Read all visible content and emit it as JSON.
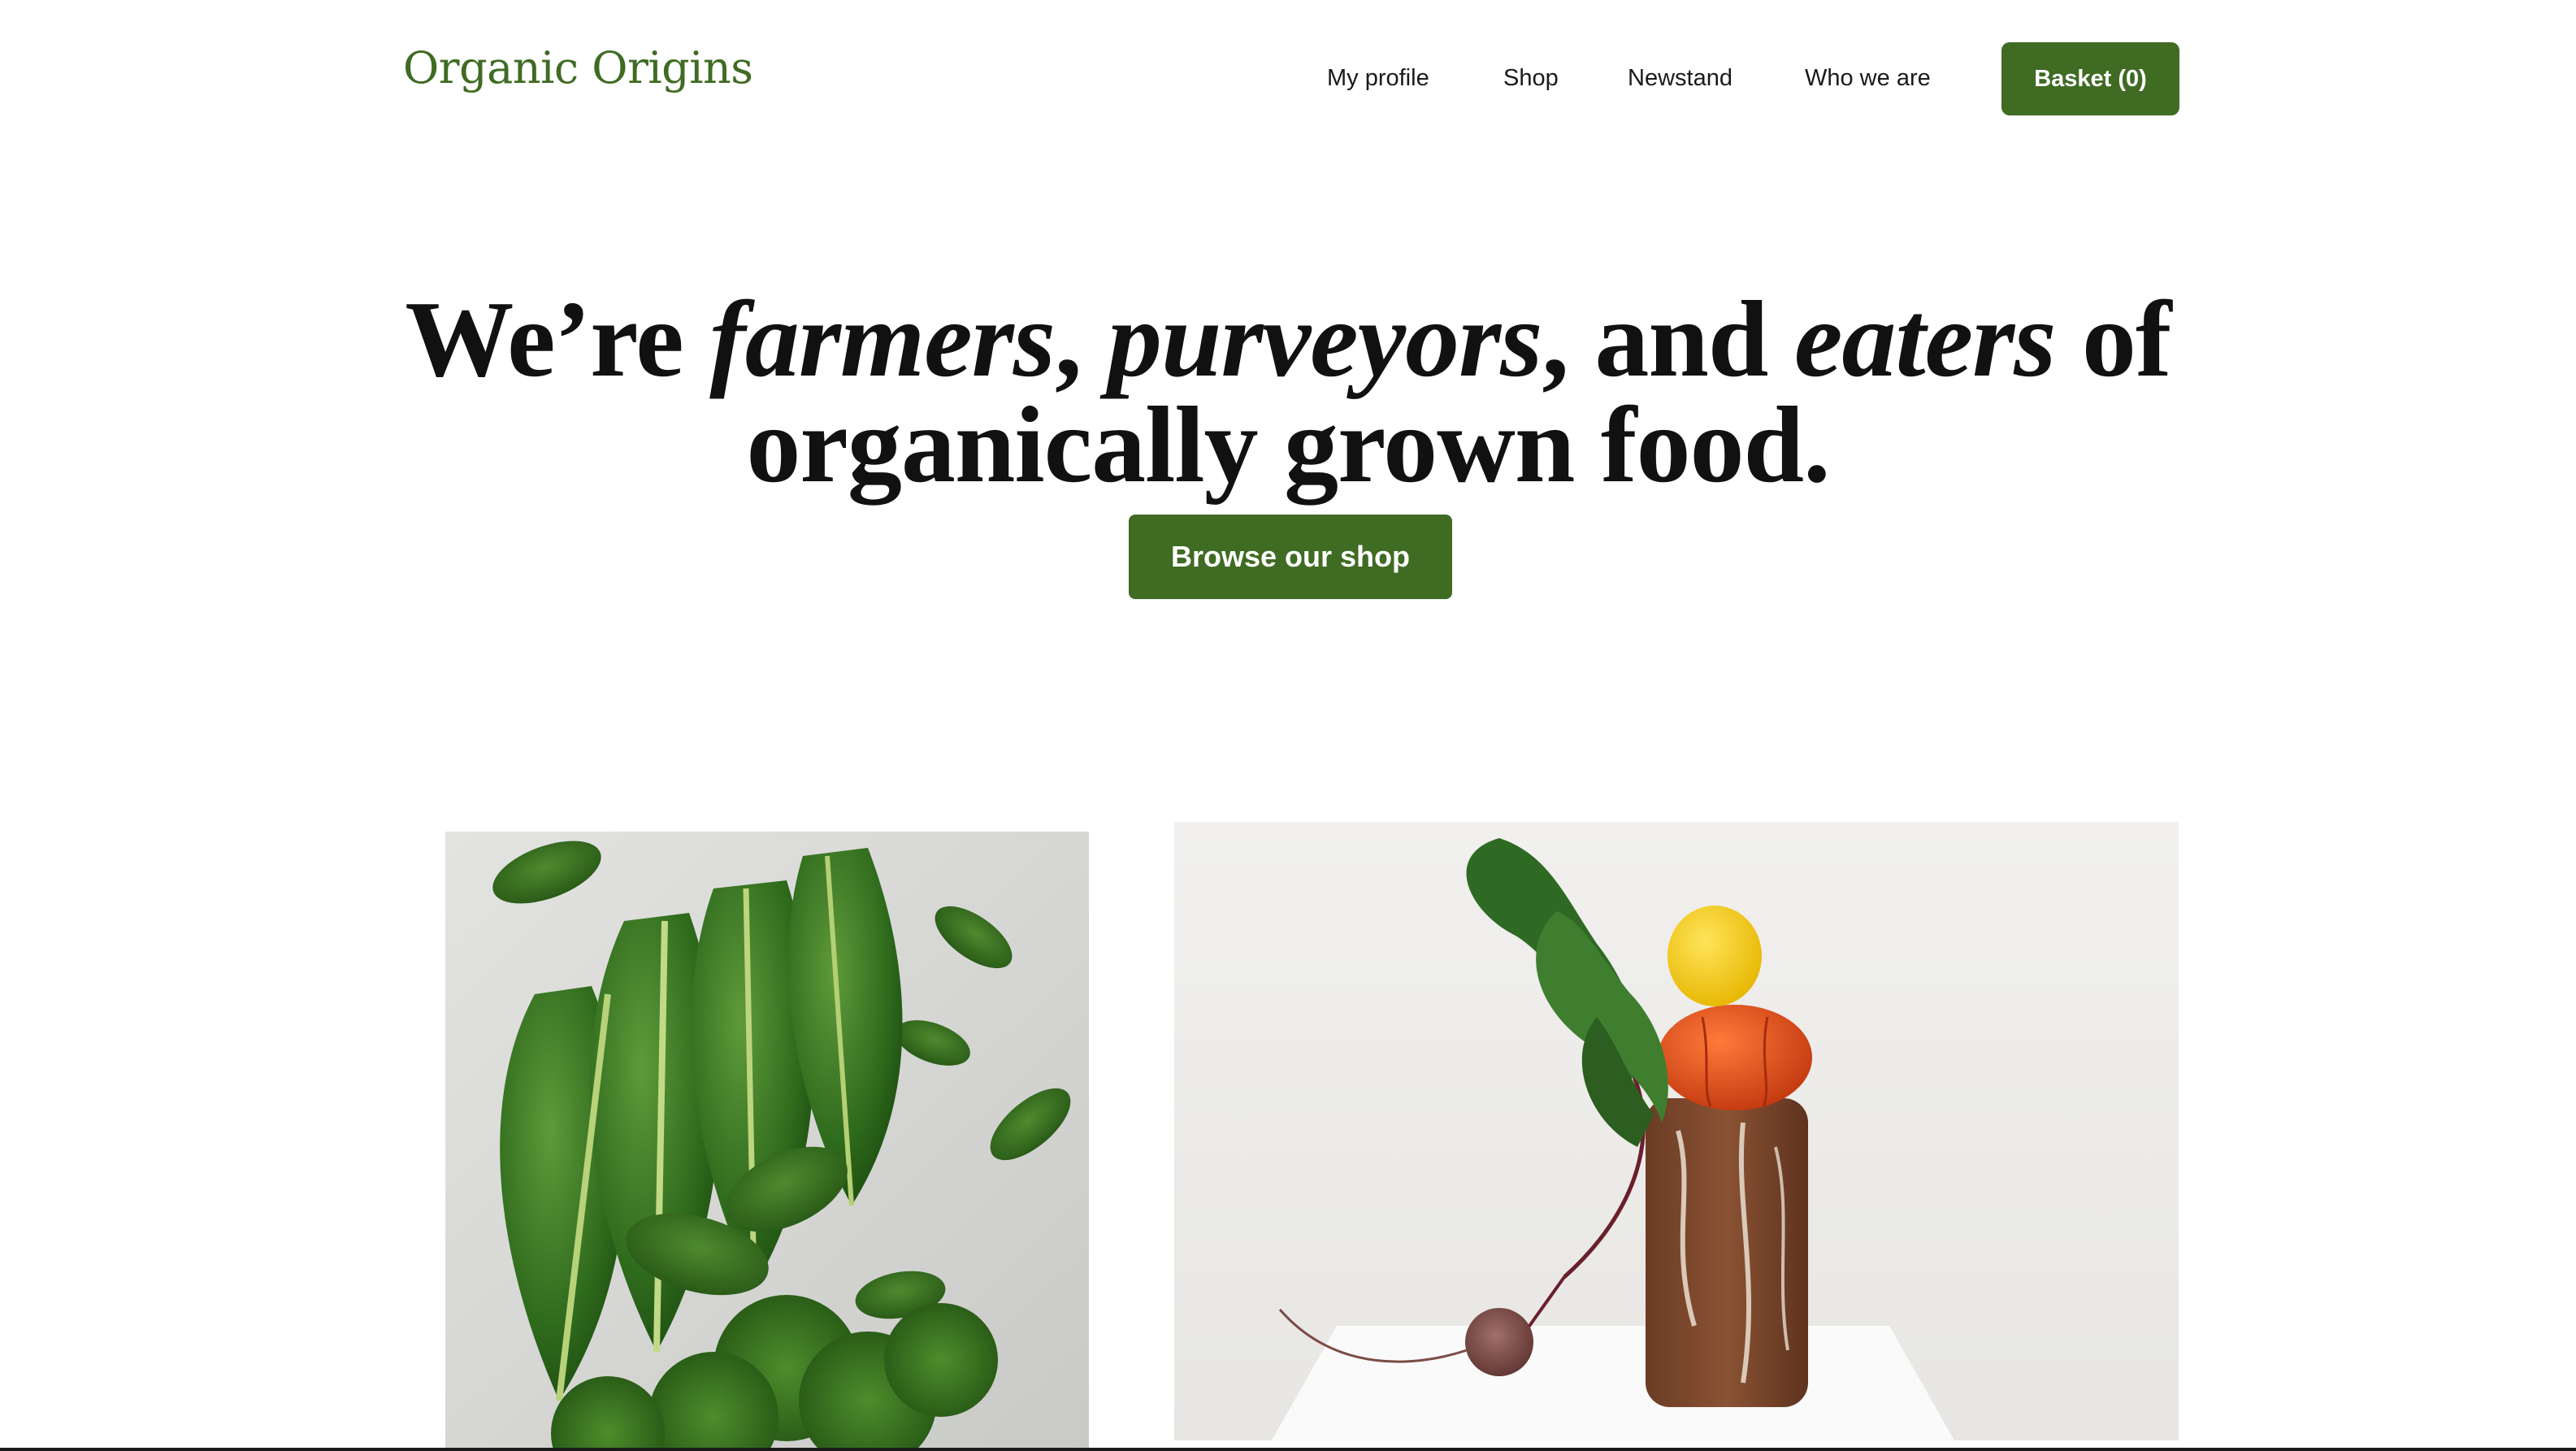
{
  "header": {
    "logo_text": "Organic Origins",
    "brand_color": "#3f6b23"
  },
  "nav": {
    "items": [
      {
        "label": "My profile"
      },
      {
        "label": "Shop"
      },
      {
        "label": "Newstand"
      },
      {
        "label": "Who we are"
      }
    ],
    "basket_label": "Basket (0)"
  },
  "hero": {
    "title_parts": {
      "p1": "We’re ",
      "farmers": "farmers",
      "p2": ", ",
      "purveyors": "purveyors",
      "p3": ", and ",
      "eaters": "eaters",
      "p4": " of",
      "line2": "organically grown food."
    },
    "cta_label": "Browse our shop"
  },
  "images": {
    "left": {
      "icon": "leafy-greens-photo"
    },
    "right": {
      "icon": "beet-bread-tomato-lemon-photo"
    }
  }
}
